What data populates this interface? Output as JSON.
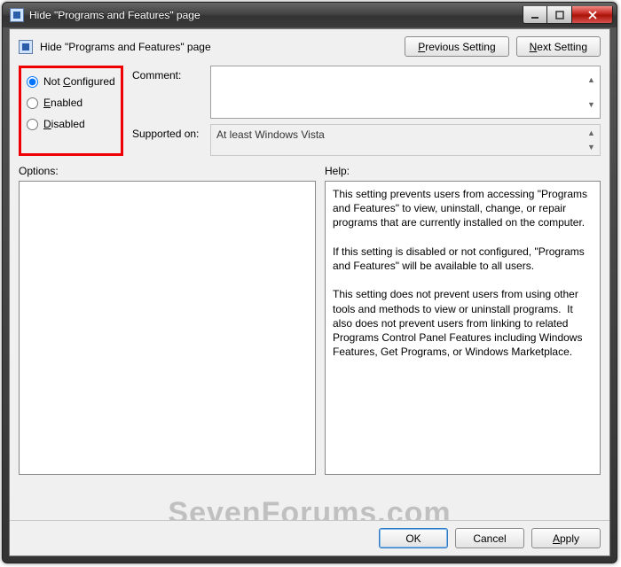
{
  "window": {
    "title": "Hide \"Programs and Features\" page"
  },
  "header": {
    "setting_title": "Hide \"Programs and Features\" page",
    "prev_label_a": "P",
    "prev_label_b": "revious Setting",
    "next_label_a": "N",
    "next_label_b": "ext Setting"
  },
  "state": {
    "not_configured_a": "Not ",
    "not_configured_u": "C",
    "not_configured_b": "onfigured",
    "enabled_u": "E",
    "enabled_b": "nabled",
    "disabled_u": "D",
    "disabled_b": "isabled",
    "selected": "not_configured"
  },
  "fields": {
    "comment_label": "Comment:",
    "comment_value": "",
    "supported_label": "Supported on:",
    "supported_value": "At least Windows Vista"
  },
  "sections": {
    "options_label": "Options:",
    "help_label": "Help:"
  },
  "help_text": "This setting prevents users from accessing \"Programs and Features\" to view, uninstall, change, or repair programs that are currently installed on the computer.\n\nIf this setting is disabled or not configured, \"Programs and Features\" will be available to all users.\n\nThis setting does not prevent users from using other tools and methods to view or uninstall programs.  It also does not prevent users from linking to related Programs Control Panel Features including Windows Features, Get Programs, or Windows Marketplace.",
  "buttons": {
    "ok": "OK",
    "cancel": "Cancel",
    "apply_u": "A",
    "apply_b": "pply"
  },
  "watermark": "SevenForums.com"
}
